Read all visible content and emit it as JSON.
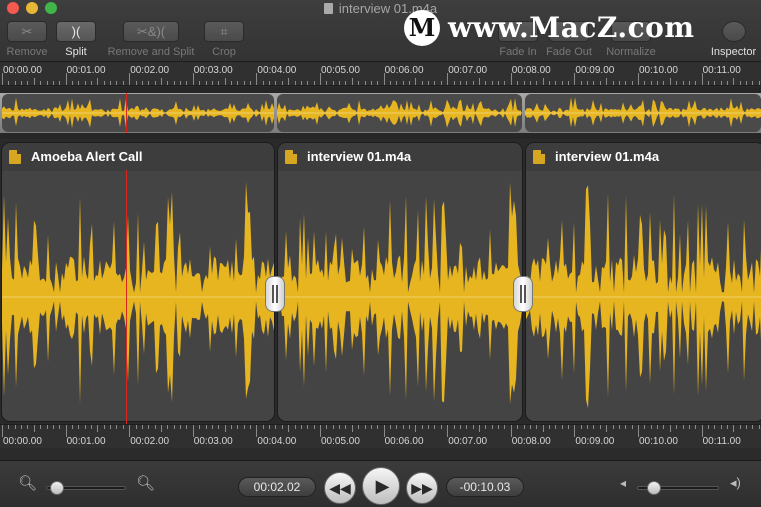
{
  "window": {
    "title": "interview 01.m4a"
  },
  "toolbar": {
    "remove": {
      "label": "Remove",
      "icon": "scissors-icon",
      "glyph": "✂"
    },
    "split": {
      "label": "Split",
      "icon": "split-icon",
      "glyph": ")("
    },
    "remove_and_split": {
      "label": "Remove and Split",
      "icon": "remove-split-icon",
      "glyph": "✂&)("
    },
    "crop": {
      "label": "Crop",
      "icon": "crop-icon",
      "glyph": "⌗"
    },
    "fade_in": {
      "label": "Fade In"
    },
    "fade_out": {
      "label": "Fade Out"
    },
    "normalize": {
      "label": "Normalize"
    },
    "inspector": {
      "label": "Inspector"
    }
  },
  "watermark": {
    "logo_letter": "M",
    "text": "www.MacZ.com"
  },
  "ruler": {
    "labels": [
      "00:00.00",
      "00:01.00",
      "00:02.00",
      "00:03.00",
      "00:04.00",
      "00:05.00",
      "00:06.00",
      "00:07.00",
      "00:08.00",
      "00:09.00",
      "00:10.00",
      "00:11.00"
    ]
  },
  "clips": [
    {
      "title": "Amoeba Alert Call",
      "icon": "audio-file-icon"
    },
    {
      "title": "interview 01.m4a",
      "icon": "audio-file-icon"
    },
    {
      "title": "interview 01.m4a",
      "icon": "audio-file-icon"
    }
  ],
  "transport": {
    "current_time": "00:02.02",
    "remaining_time": "-00:10.03",
    "zoom_level": 0.05,
    "volume_level": 0.12,
    "rewind_icon": "rewind-icon",
    "play_icon": "play-icon",
    "forward_icon": "fast-forward-icon"
  },
  "colors": {
    "waveform": "#e6b520",
    "playhead": "#d9271d",
    "clip_bg": "#444444"
  }
}
